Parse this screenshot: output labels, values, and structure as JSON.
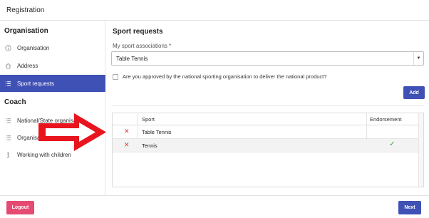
{
  "header": {
    "title": "Registration"
  },
  "sidebar": {
    "sections": [
      {
        "title": "Organisation",
        "items": [
          {
            "label": "Organisation",
            "icon": "info-icon",
            "active": false
          },
          {
            "label": "Address",
            "icon": "home-icon",
            "active": false
          },
          {
            "label": "Sport requests",
            "icon": "list-icon",
            "active": true
          }
        ]
      },
      {
        "title": "Coach",
        "items": [
          {
            "label": "National/State organisation",
            "icon": "list-icon",
            "active": false
          },
          {
            "label": "Organisation",
            "icon": "list-icon",
            "active": false
          },
          {
            "label": "Working with children",
            "icon": "child-icon",
            "active": false
          }
        ]
      }
    ]
  },
  "main": {
    "title": "Sport requests",
    "sport_associations": {
      "label": "My sport associations *",
      "value": "Table Tennis"
    },
    "approval_checkbox": {
      "label": "Are you approved by the national sporting organisation to deliver the national product?",
      "checked": false
    },
    "add_label": "Add",
    "table": {
      "columns": [
        "",
        "Sport",
        "Endorsement"
      ],
      "rows": [
        {
          "sport": "Table Tennis",
          "endorsed": false
        },
        {
          "sport": "Tennis",
          "endorsed": true
        }
      ]
    }
  },
  "footer": {
    "logout_label": "Logout",
    "next_label": "Next"
  },
  "colors": {
    "primary": "#3f51b5",
    "danger": "#e64a72",
    "arrow": "#e8141e",
    "success": "#43a047"
  }
}
